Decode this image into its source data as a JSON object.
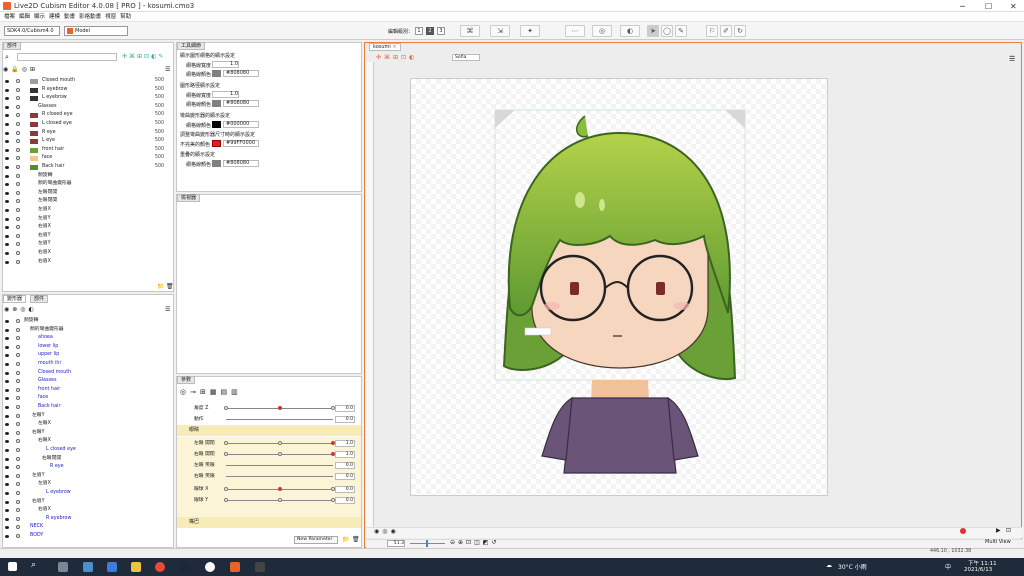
{
  "window": {
    "title": "Live2D Cubism Editor 4.0.08  [ PRO ]  - kosumi.cmo3",
    "min": "─",
    "max": "☐",
    "close": "✕"
  },
  "menu": [
    "檔案",
    "編輯",
    "顯示",
    "建模",
    "動畫",
    "影格動畫",
    "視窗",
    "幫助"
  ],
  "toolbar": {
    "version_select": "SDK4.0/Cubism4.0",
    "mode_select": "Model",
    "edit_level_label": "編輯級別：",
    "levels": [
      "1",
      "2",
      "3"
    ]
  },
  "parts_panel": {
    "tab": "部件",
    "rows": [
      {
        "name": "Closed mouth",
        "value": "500",
        "c": "#9e9e9e"
      },
      {
        "name": "R eyebrow",
        "value": "500",
        "c": "#333"
      },
      {
        "name": "L eyebrow",
        "value": "500",
        "c": "#333"
      },
      {
        "name": "Glasses",
        "value": "500",
        "c": ""
      },
      {
        "name": "R closed eye",
        "value": "500",
        "c": "#8a3a3a"
      },
      {
        "name": "L closed eye",
        "value": "500",
        "c": "#8a3a3a"
      },
      {
        "name": "R eye",
        "value": "500",
        "c": "#8a3a3a"
      },
      {
        "name": "L eye",
        "value": "500",
        "c": "#8a3a3a"
      },
      {
        "name": "front hair",
        "value": "500",
        "c": "#6aa03a"
      },
      {
        "name": "face",
        "value": "500",
        "c": "#f2c49a"
      },
      {
        "name": "Back hair",
        "value": "500",
        "c": "#5a8a30"
      },
      {
        "name": "顏旋轉",
        "value": "",
        "c": ""
      },
      {
        "name": "顏的彎曲變形器",
        "value": "",
        "c": ""
      },
      {
        "name": "左眼閉開",
        "value": "",
        "c": ""
      },
      {
        "name": "左眼閉開",
        "value": "",
        "c": ""
      },
      {
        "name": "左眉X",
        "value": "",
        "c": ""
      },
      {
        "name": "左眉Y",
        "value": "",
        "c": ""
      },
      {
        "name": "右眉X",
        "value": "",
        "c": ""
      },
      {
        "name": "右眉Y",
        "value": "",
        "c": ""
      },
      {
        "name": "左眉Y",
        "value": "",
        "c": ""
      },
      {
        "name": "右眉X",
        "value": "",
        "c": ""
      },
      {
        "name": "右眉X",
        "value": "",
        "c": ""
      }
    ]
  },
  "tool_detail": {
    "tab": "工具細節",
    "s1": "顯示圖形網格的顯示設定",
    "s1a": "網格線寬度",
    "s1a_v": "1.0",
    "s1b": "網格線顏色",
    "s1b_v": "#808080",
    "s2": "圖形路徑顯示設定",
    "s2a": "網格線寬度",
    "s2a_v": "1.0",
    "s2b": "網格線顏色",
    "s2b_v": "#808080",
    "s3": "彎曲變形器的顯示設定",
    "s3a": "網格線顏色",
    "s3a_v": "#000000",
    "s4": "調整彎曲變形器尺寸時的顯示設定",
    "s4a": "不完美的顏色",
    "s4a_v": "#99FF0000",
    "s5": "重疊的顯示設定",
    "s5a": "網格線顏色",
    "s5a_v": "#808080"
  },
  "inspector": {
    "tab": "檢視器"
  },
  "deformer_panel": {
    "tabs": [
      "變形器",
      "部件"
    ],
    "rows": [
      {
        "name": "顏旋轉",
        "ind": 22,
        "c": "#222"
      },
      {
        "name": "顏的彎曲變形器",
        "ind": 28,
        "c": "#222"
      },
      {
        "name": "ahoea",
        "ind": 36,
        "c": "#1a1acc"
      },
      {
        "name": "lower lip",
        "ind": 36,
        "c": "#1a1acc"
      },
      {
        "name": "upper lip",
        "ind": 36,
        "c": "#1a1acc"
      },
      {
        "name": "mouth ihi",
        "ind": 36,
        "c": "#1a1acc"
      },
      {
        "name": "Closed mouth",
        "ind": 36,
        "c": "#1a1acc"
      },
      {
        "name": "Glasses",
        "ind": 36,
        "c": "#1a1acc"
      },
      {
        "name": "front hair",
        "ind": 36,
        "c": "#1a1acc"
      },
      {
        "name": "face",
        "ind": 36,
        "c": "#1a1acc"
      },
      {
        "name": "Back hair",
        "ind": 36,
        "c": "#1a1acc"
      },
      {
        "name": "左眼Y",
        "ind": 30,
        "c": "#222"
      },
      {
        "name": "左眼X",
        "ind": 36,
        "c": "#222"
      },
      {
        "name": "右眼Y",
        "ind": 30,
        "c": "#222"
      },
      {
        "name": "右眼X",
        "ind": 36,
        "c": "#222"
      },
      {
        "name": "L closed eye",
        "ind": 44,
        "c": "#1a1acc"
      },
      {
        "name": "右眼閉開",
        "ind": 40,
        "c": "#222"
      },
      {
        "name": "R eye",
        "ind": 48,
        "c": "#1a1acc"
      },
      {
        "name": "左眉Y",
        "ind": 30,
        "c": "#222"
      },
      {
        "name": "左眉X",
        "ind": 36,
        "c": "#222"
      },
      {
        "name": "L eyebrow",
        "ind": 44,
        "c": "#1a1acc"
      },
      {
        "name": "右眉Y",
        "ind": 30,
        "c": "#222"
      },
      {
        "name": "右眉X",
        "ind": 36,
        "c": "#222"
      },
      {
        "name": "R eyebrow",
        "ind": 44,
        "c": "#1a1acc"
      },
      {
        "name": "NECK",
        "ind": 28,
        "c": "#1a1acc"
      },
      {
        "name": "BODY",
        "ind": 28,
        "c": "#1a1acc"
      }
    ]
  },
  "params": {
    "tab": "參數",
    "group1": "眼睛",
    "group2": "嘴巴",
    "new_param": "New Parameter",
    "rows": [
      {
        "name": "角度 Z",
        "value": "0.0",
        "kf": [
          0,
          0.5,
          1
        ],
        "red": 1
      },
      {
        "name": "動作",
        "value": "0.0",
        "kf": [],
        "red": -1
      },
      {
        "name": "左眼 開閉",
        "value": "1.0",
        "kf": [
          0,
          0.5,
          1
        ],
        "red": 2
      },
      {
        "name": "右眼 開閉",
        "value": "1.0",
        "kf": [
          0,
          0.5,
          1
        ],
        "red": 2
      },
      {
        "name": "左眼 笑眼",
        "value": "0.0",
        "kf": [],
        "red": -1
      },
      {
        "name": "右眼 笑眼",
        "value": "0.0",
        "kf": [],
        "red": -1
      },
      {
        "name": "眼球 X",
        "value": "0.0",
        "kf": [
          0,
          0.5,
          1
        ],
        "red": 1
      },
      {
        "name": "眼球 Y",
        "value": "0.0",
        "kf": [
          0,
          0.5,
          1
        ],
        "red": -1
      }
    ]
  },
  "canvas": {
    "tab": "kosumi",
    "status_zoom": "51.3",
    "coord": "446.10 , 1032.38",
    "sub": "Multi View",
    "scroll_label": "Sofia"
  },
  "taskbar": {
    "weather": "30°C 小雨",
    "time": "下午 11:11",
    "date": "2021/6/13",
    "lang": "中"
  }
}
